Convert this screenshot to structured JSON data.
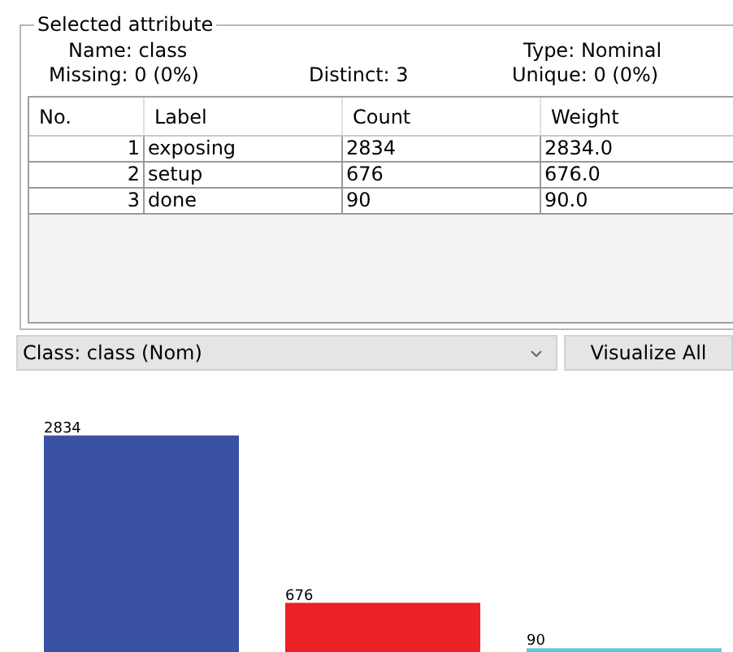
{
  "panel": {
    "title": "Selected attribute",
    "name": {
      "label": "Name:",
      "value": "class"
    },
    "type": {
      "label": "Type:",
      "value": "Nominal"
    },
    "missing": {
      "label": "Missing:",
      "value": "0 (0%)"
    },
    "distinct": {
      "label": "Distinct:",
      "value": "3"
    },
    "unique": {
      "label": "Unique:",
      "value": "0 (0%)"
    },
    "table": {
      "columns": [
        "No.",
        "Label",
        "Count",
        "Weight"
      ],
      "rows": [
        [
          "1",
          "exposing",
          "2834",
          "2834.0"
        ],
        [
          "2",
          "setup",
          "676",
          "676.0"
        ],
        [
          "3",
          "done",
          "90",
          "90.0"
        ]
      ]
    }
  },
  "class_select": {
    "value": "Class: class (Nom)"
  },
  "visualize_button": "Visualize All",
  "chart": {
    "chart_data": {
      "type": "bar",
      "values": [
        2834,
        676,
        90
      ],
      "colors": [
        "#3a52a4",
        "#ea2127",
        "#5cc8d6"
      ],
      "data_labels": true
    }
  }
}
